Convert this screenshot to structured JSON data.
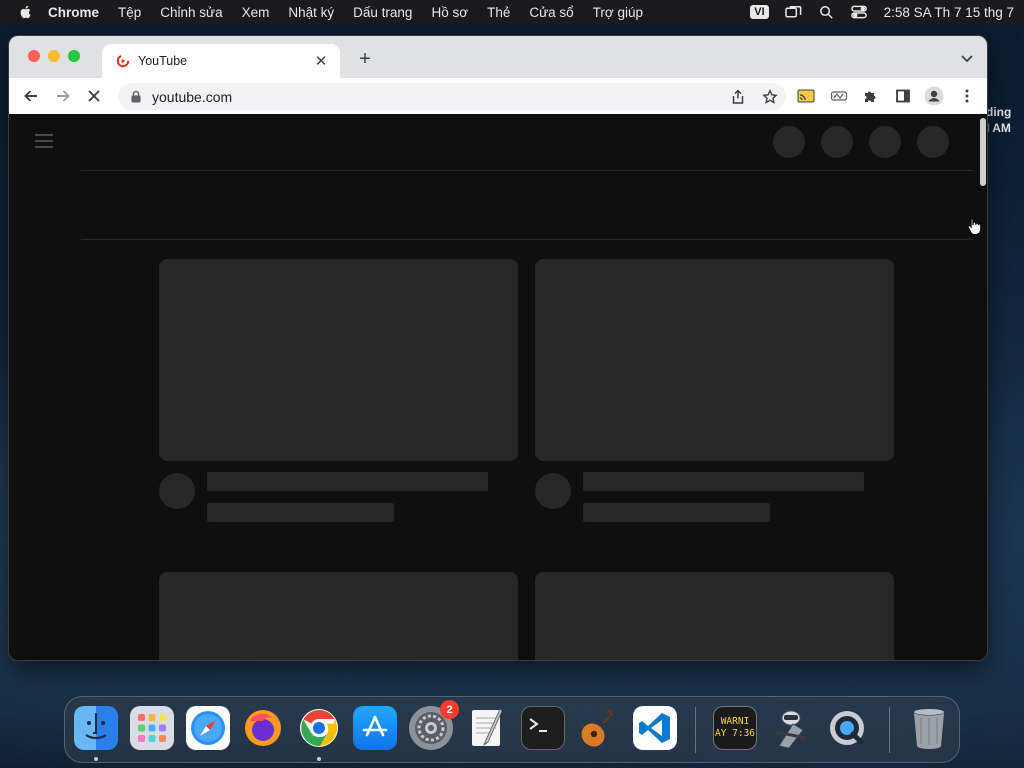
{
  "menubar": {
    "app_name": "Chrome",
    "items": [
      "Tệp",
      "Chỉnh sửa",
      "Xem",
      "Nhật ký",
      "Dấu trang",
      "Hồ sơ",
      "Thẻ",
      "Cửa sổ",
      "Trợ giúp"
    ],
    "input_source": "VI",
    "clock": "2:58 SA Th 7 15 thg 7"
  },
  "desktop": {
    "partial_text_1": "ding",
    "partial_text_2": "I AM"
  },
  "browser": {
    "tab": {
      "title": "YouTube"
    },
    "address": {
      "url": "youtube.com"
    }
  },
  "dock": {
    "items": [
      "finder",
      "launchpad",
      "safari",
      "firefox",
      "chrome",
      "app-store",
      "system-preferences",
      "textedit",
      "terminal",
      "garageband",
      "vscode",
      "console",
      "automator",
      "quicktime",
      "trash"
    ],
    "system_preferences_badge": "2",
    "console_text_1": "WARNI",
    "console_text_2": "AY 7:36"
  },
  "colors": {
    "page_bg": "#0f0f0f",
    "skeleton": "#272727",
    "tabstrip": "#dfe1e5"
  }
}
